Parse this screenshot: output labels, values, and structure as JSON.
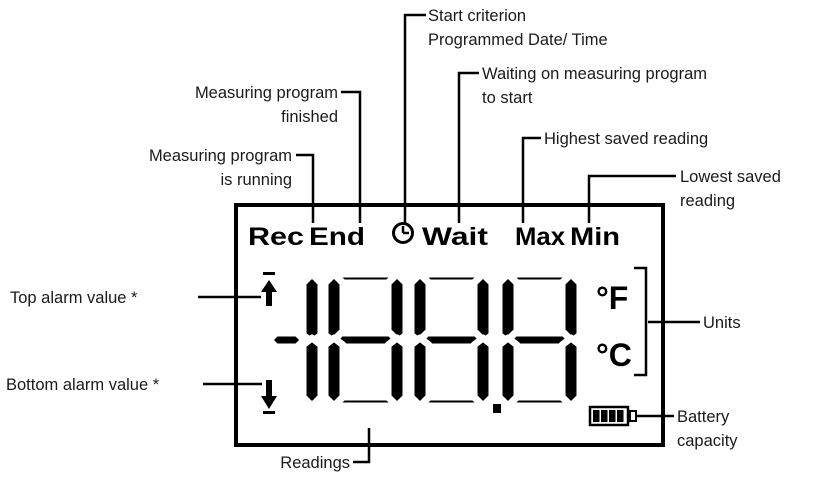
{
  "indicators": {
    "rec": "Rec",
    "end": "End",
    "wait": "Wait",
    "max": "Max",
    "min": "Min",
    "clock_icon": "clock-icon"
  },
  "units": {
    "fahrenheit": "°F",
    "celsius": "°C"
  },
  "display": {
    "digits": "188.8"
  },
  "labels": {
    "start_criterion_line1": "Start criterion",
    "start_criterion_line2": "Programmed Date/ Time",
    "waiting_line1": "Waiting on measuring program",
    "waiting_line2": "to start",
    "finished_line1": "Measuring program",
    "finished_line2": "finished",
    "highest": "Highest saved reading",
    "running_line1": "Measuring program",
    "running_line2": "is running",
    "lowest_line1": "Lowest saved",
    "lowest_line2": "reading",
    "top_alarm": "Top alarm value *",
    "bottom_alarm": "Bottom alarm value *",
    "units": "Units",
    "battery_line1": "Battery",
    "battery_line2": "capacity",
    "readings": "Readings"
  }
}
